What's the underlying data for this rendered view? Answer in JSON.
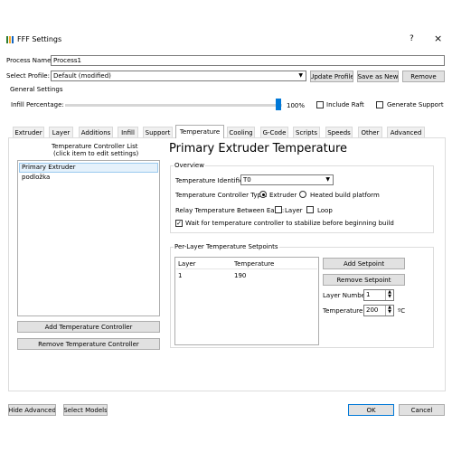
{
  "window": {
    "title": "FFF Settings",
    "help": "?",
    "close": "×"
  },
  "process_name": {
    "label": "Process Name:",
    "value": "Process1"
  },
  "select_profile": {
    "label": "Select Profile:",
    "value": "Default (modified)",
    "update": "Update Profile",
    "save_as_new": "Save as New",
    "remove": "Remove"
  },
  "general": {
    "title": "General Settings",
    "infill_label": "Infill Percentage:",
    "infill_value": "100%",
    "infill_fraction": 1.0,
    "include_raft": "Include Raft",
    "generate_support": "Generate Support"
  },
  "tabs": [
    {
      "label": "Extruder"
    },
    {
      "label": "Layer"
    },
    {
      "label": "Additions"
    },
    {
      "label": "Infill"
    },
    {
      "label": "Support"
    },
    {
      "label": "Temperature"
    },
    {
      "label": "Cooling"
    },
    {
      "label": "G-Code"
    },
    {
      "label": "Scripts"
    },
    {
      "label": "Speeds"
    },
    {
      "label": "Other"
    },
    {
      "label": "Advanced"
    }
  ],
  "controller_list": {
    "title1": "Temperature Controller List",
    "title2": "(click item to edit settings)",
    "items": [
      {
        "label": "Primary Extruder"
      },
      {
        "label": "podložka"
      }
    ],
    "add": "Add Temperature Controller",
    "remove": "Remove Temperature Controller"
  },
  "primary": {
    "heading": "Primary Extruder Temperature",
    "overview": "Overview",
    "identifier_label": "Temperature Identifier",
    "identifier_value": "T0",
    "type_label": "Temperature Controller Type:",
    "type_extruder": "Extruder",
    "type_heated": "Heated build platform",
    "relay_label": "Relay Temperature Between Each:",
    "relay_layer": "Layer",
    "relay_loop": "Loop",
    "wait": "Wait for temperature controller to stabilize before beginning build"
  },
  "setpoints": {
    "title": "Per-Layer Temperature Setpoints",
    "col_layer": "Layer",
    "col_temp": "Temperature",
    "rows": [
      {
        "layer": "1",
        "temp": "190"
      }
    ],
    "add": "Add Setpoint",
    "remove": "Remove Setpoint",
    "layer_number_label": "Layer Number",
    "layer_number_value": "1",
    "temperature_label": "Temperature",
    "temperature_value": "200",
    "unit": "ºC"
  },
  "footer": {
    "hide_advanced": "Hide Advanced",
    "select_models": "Select Models",
    "ok": "OK",
    "cancel": "Cancel"
  }
}
